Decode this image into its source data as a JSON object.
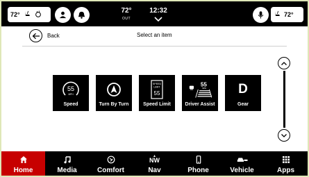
{
  "status_bar": {
    "driver_temp": "72°",
    "passenger_temp": "72°",
    "outside_temp": "72°",
    "outside_label": "OUT",
    "time": "12:32"
  },
  "header": {
    "back_label": "Back",
    "title": "Select an item"
  },
  "tiles": [
    {
      "label": "Speed",
      "value": "55",
      "unit": "MPH",
      "icon": "speedometer-icon"
    },
    {
      "label": "Turn By Turn",
      "icon": "navigation-arrow-icon"
    },
    {
      "label": "Speed Limit",
      "sign_top": "SPEED",
      "sign_mid": "LIMIT",
      "sign_value": "55",
      "icon": "speed-limit-sign-icon"
    },
    {
      "label": "Driver Assist",
      "value": "55",
      "unit": "MPH",
      "icon": "driver-assist-icon"
    },
    {
      "label": "Gear",
      "value": "D",
      "icon": "gear-indicator-icon"
    }
  ],
  "nav": [
    {
      "label": "Home",
      "icon": "home-icon",
      "active": true
    },
    {
      "label": "Media",
      "icon": "music-note-icon"
    },
    {
      "label": "Comfort",
      "icon": "comfort-icon"
    },
    {
      "label": "Nav",
      "icon": "compass-icon",
      "direction": "NW"
    },
    {
      "label": "Phone",
      "icon": "phone-icon"
    },
    {
      "label": "Vehicle",
      "icon": "vehicle-icon"
    },
    {
      "label": "Apps",
      "icon": "apps-grid-icon"
    }
  ],
  "colors": {
    "active_nav": "#c70000",
    "background": "#000000",
    "content_bg": "#ffffff"
  }
}
